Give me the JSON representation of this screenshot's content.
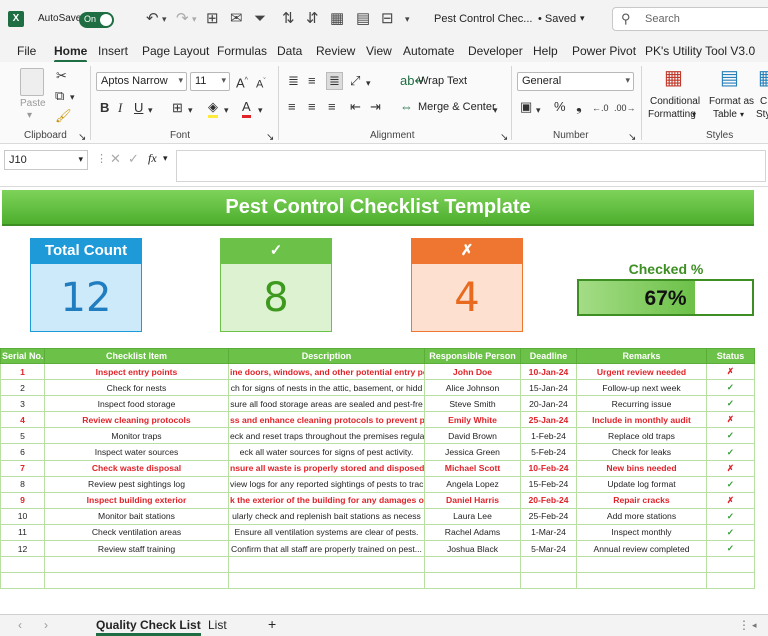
{
  "titlebar": {
    "autosave_label": "AutoSave",
    "autosave_state": "On",
    "doc_title": "Pest Control Chec...",
    "saved_status": "• Saved",
    "search_placeholder": "Search"
  },
  "menu": [
    "File",
    "Home",
    "Insert",
    "Page Layout",
    "Formulas",
    "Data",
    "Review",
    "View",
    "Automate",
    "Developer",
    "Help",
    "Power Pivot",
    "PK's Utility Tool V3.0"
  ],
  "ribbon": {
    "paste_label": "Paste",
    "clipboard_label": "Clipboard",
    "font_name": "Aptos Narrow",
    "font_size": "11",
    "font_label": "Font",
    "wrap_text": "Wrap Text",
    "merge_center": "Merge & Center",
    "alignment_label": "Alignment",
    "number_format": "General",
    "number_label": "Number",
    "cond_fmt_1": "Conditional",
    "cond_fmt_2": "Formatting",
    "format_table_1": "Format as",
    "format_table_2": "Table",
    "styles_label": "Styles",
    "cell_styles_1": "C",
    "cell_styles_2": "Sty"
  },
  "formula_bar": {
    "name_box": "J10",
    "fx": "fx"
  },
  "sheet": {
    "banner_title": "Pest Control Checklist Template",
    "total_label": "Total Count",
    "total_value": "12",
    "check_label": "✓",
    "check_value": "8",
    "x_label": "✗",
    "x_value": "4",
    "checked_pct_label": "Checked %",
    "checked_pct_text": "67%",
    "checked_pct_fraction": 0.67,
    "colors": {
      "green": "#6cc148",
      "blue": "#1f9ad9",
      "orange": "#ef7630",
      "red": "#e0242a"
    }
  },
  "table": {
    "headers": [
      "Serial No.",
      "Checklist Item",
      "Description",
      "Responsible Person",
      "Deadline",
      "Remarks",
      "Status"
    ],
    "rows": [
      {
        "no": "1",
        "item": "Inspect entry points",
        "desc": "ine doors, windows, and other potential entry po",
        "person": "John Doe",
        "deadline": "10-Jan-24",
        "remarks": "Urgent review needed",
        "status": "✗",
        "red": true
      },
      {
        "no": "2",
        "item": "Check for nests",
        "desc": "ch for signs of nests in the attic, basement, or hidd",
        "person": "Alice Johnson",
        "deadline": "15-Jan-24",
        "remarks": "Follow-up next week",
        "status": "✓",
        "red": false
      },
      {
        "no": "3",
        "item": "Inspect food storage",
        "desc": "sure all food storage areas are sealed and pest-fre",
        "person": "Steve Smith",
        "deadline": "20-Jan-24",
        "remarks": "Recurring issue",
        "status": "✓",
        "red": false
      },
      {
        "no": "4",
        "item": "Review cleaning protocols",
        "desc": "ss and enhance cleaning protocols to prevent pe",
        "person": "Emily White",
        "deadline": "25-Jan-24",
        "remarks": "Include in monthly audit",
        "status": "✗",
        "red": true
      },
      {
        "no": "5",
        "item": "Monitor traps",
        "desc": "eck and reset traps throughout the premises regula",
        "person": "David Brown",
        "deadline": "1-Feb-24",
        "remarks": "Replace old traps",
        "status": "✓",
        "red": false
      },
      {
        "no": "6",
        "item": "Inspect water sources",
        "desc": "eck all water sources for signs of pest activity.",
        "person": "Jessica Green",
        "deadline": "5-Feb-24",
        "remarks": "Check for leaks",
        "status": "✓",
        "red": false
      },
      {
        "no": "7",
        "item": "Check waste disposal",
        "desc": "nsure all waste is properly stored and disposed o",
        "person": "Michael Scott",
        "deadline": "10-Feb-24",
        "remarks": "New bins needed",
        "status": "✗",
        "red": true
      },
      {
        "no": "8",
        "item": "Review pest sightings log",
        "desc": "view logs for any reported sightings of pests to trac",
        "person": "Angela Lopez",
        "deadline": "15-Feb-24",
        "remarks": "Update log format",
        "status": "✓",
        "red": false
      },
      {
        "no": "9",
        "item": "Inspect building exterior",
        "desc": "k the exterior of the building for any damages or e",
        "person": "Daniel Harris",
        "deadline": "20-Feb-24",
        "remarks": "Repair cracks",
        "status": "✗",
        "red": true
      },
      {
        "no": "10",
        "item": "Monitor bait stations",
        "desc": "ularly check and replenish bait stations as necess",
        "person": "Laura Lee",
        "deadline": "25-Feb-24",
        "remarks": "Add more stations",
        "status": "✓",
        "red": false
      },
      {
        "no": "11",
        "item": "Check ventilation areas",
        "desc": "Ensure all ventilation systems are clear of pests.",
        "person": "Rachel Adams",
        "deadline": "1-Mar-24",
        "remarks": "Inspect monthly",
        "status": "✓",
        "red": false
      },
      {
        "no": "12",
        "item": "Review staff training",
        "desc": "Confirm that all staff are properly trained on pest...",
        "person": "Joshua Black",
        "deadline": "5-Mar-24",
        "remarks": "Annual review completed",
        "status": "✓",
        "red": false
      }
    ]
  },
  "tabs": {
    "active": "Quality Check List",
    "other": "List",
    "add": "+"
  }
}
